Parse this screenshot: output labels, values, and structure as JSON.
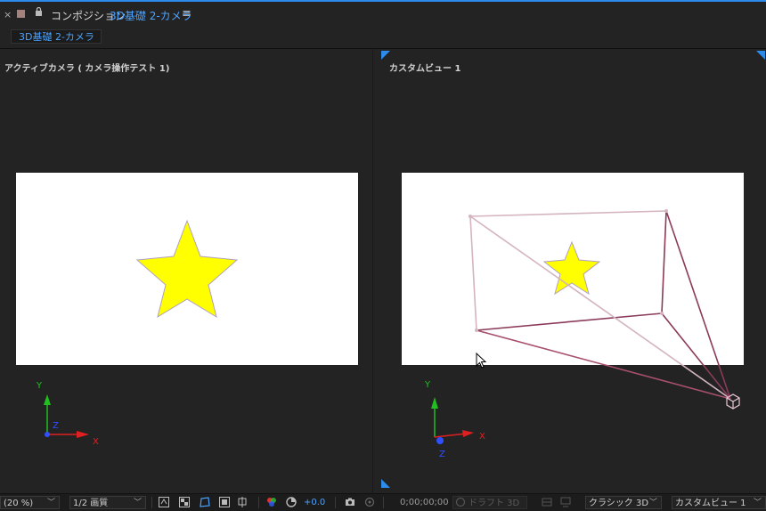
{
  "header": {
    "close_label": "×",
    "title_prefix": "コンポジション",
    "comp_name": "3D基礎 2-カメラ",
    "menu_label": "≡"
  },
  "tab": {
    "label": "3D基礎 2-カメラ"
  },
  "views": {
    "left": {
      "label": "アクティブカメラ ( カメラ操作テスト 1)",
      "axis_x": "X",
      "axis_y": "Y",
      "axis_z": "Z"
    },
    "right": {
      "label": "カスタムビュー 1",
      "axis_x": "X",
      "axis_y": "Y",
      "axis_z": "Z"
    }
  },
  "toolbar": {
    "zoom": "(20 %)",
    "resolution": "1/2 画質",
    "exposure": "+0.0",
    "timecode": "0;00;00;00",
    "draft3d": "ドラフト 3D",
    "renderer": "クラシック 3D",
    "view": "カスタムビュー 1"
  },
  "colors": {
    "accent": "#4aa3ff",
    "star_fill": "#ffff00",
    "camera_frame": "#8b3a5a",
    "axis_x": "#e02020",
    "axis_y": "#20c020",
    "axis_z": "#3050ff"
  }
}
